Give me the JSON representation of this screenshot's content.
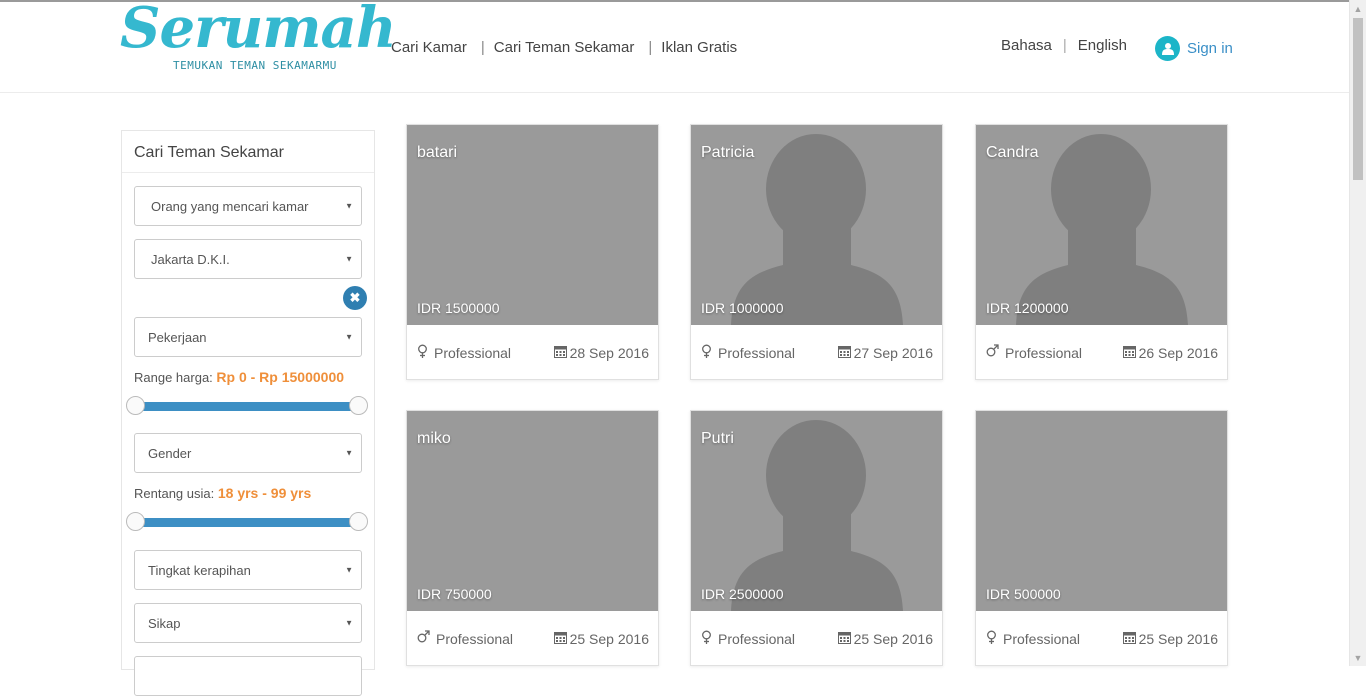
{
  "header": {
    "logo_text": "Serumah",
    "logo_tagline": "TEMUKAN TEMAN SEKAMARMU",
    "nav": [
      {
        "label": "Cari Kamar"
      },
      {
        "label": "Cari Teman Sekamar"
      },
      {
        "label": "Iklan Gratis"
      }
    ],
    "lang_primary": "Bahasa",
    "lang_secondary": "English",
    "signin_label": "Sign in",
    "accent_color": "#1cb5c8"
  },
  "sidebar": {
    "title": "Cari Teman Sekamar",
    "type_select": "Orang yang mencari kamar",
    "city_select": "Jakarta D.K.I.",
    "job_select": "Pekerjaan",
    "price_label": "Range harga:",
    "price_value": "Rp 0 - Rp 15000000",
    "gender_select": "Gender",
    "age_label": "Rentang usia:",
    "age_value": "18 yrs - 99 yrs",
    "tidiness_select": "Tingkat kerapihan",
    "attitude_select": "Sikap",
    "slider_color": "#3d8fc4",
    "highlight_color": "#ef8f3a"
  },
  "listings": [
    {
      "name": "batari",
      "price": "IDR 1500000",
      "occupation": "Professional",
      "date": "28 Sep 2016",
      "gender_icon": "female-icon",
      "photo": "photo"
    },
    {
      "name": "Patricia",
      "price": "IDR 1000000",
      "occupation": "Professional",
      "date": "27 Sep 2016",
      "gender_icon": "female-icon",
      "photo": "placeholder"
    },
    {
      "name": "Candra",
      "price": "IDR 1200000",
      "occupation": "Professional",
      "date": "26 Sep 2016",
      "gender_icon": "male-icon",
      "photo": "placeholder"
    },
    {
      "name": "miko",
      "price": "IDR 750000",
      "occupation": "Professional",
      "date": "25 Sep 2016",
      "gender_icon": "male-icon",
      "photo": "photo"
    },
    {
      "name": "Putri",
      "price": "IDR 2500000",
      "occupation": "Professional",
      "date": "25 Sep 2016",
      "gender_icon": "female-icon",
      "photo": "placeholder"
    },
    {
      "name": "",
      "price": "IDR 500000",
      "occupation": "Professional",
      "date": "25 Sep 2016",
      "gender_icon": "female-icon",
      "photo": "photo"
    }
  ]
}
